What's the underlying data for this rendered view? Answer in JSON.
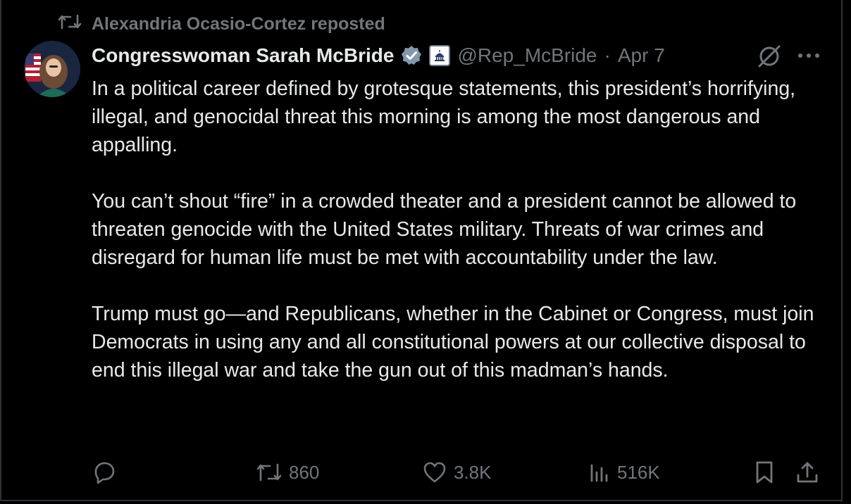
{
  "repost": {
    "label": "Alexandria Ocasio-Cortez reposted",
    "icon": "repost-icon"
  },
  "author": {
    "name": "Congresswoman Sarah McBride",
    "handle": "@Rep_McBride",
    "separator": "·",
    "date": "Apr 7",
    "verified_color": "#829aab"
  },
  "tweet": {
    "paragraphs": [
      "In a political career defined by grotesque statements, this president’s horrifying, illegal, and genocidal threat this morning is among the most dangerous and appalling.",
      "You can’t shout “fire” in a crowded theater and a president cannot be allowed to threaten genocide with the United States military. Threats of war crimes and disregard for human life must be met with accountability under the law.",
      "Trump must go—and Republicans, whether in the Cabinet or Congress, must join Democrats in using any and all constitutional powers at our collective disposal to end this illegal war and take the gun out of this madman’s hands."
    ]
  },
  "actions": {
    "reply_count": "",
    "retweet_count": "860",
    "like_count": "3.8K",
    "views_count": "516K"
  },
  "colors": {
    "background": "#000000",
    "text": "#e7e9ea",
    "muted": "#71767b"
  }
}
